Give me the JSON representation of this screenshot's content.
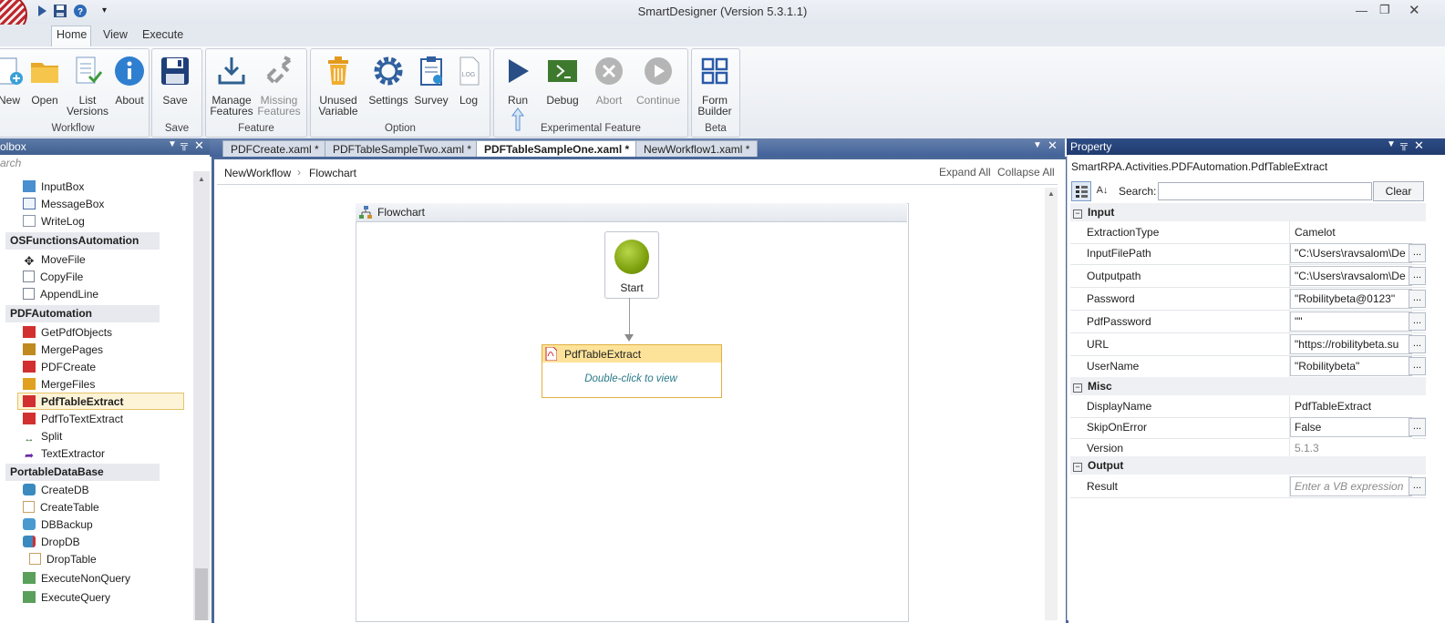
{
  "window": {
    "title": "SmartDesigner (Version 5.3.1.1)"
  },
  "ribbon": {
    "tabs": [
      "Home",
      "View",
      "Execute"
    ],
    "groups": [
      {
        "label": "Workflow",
        "buttons": [
          "New",
          "Open",
          "List Versions",
          "About"
        ]
      },
      {
        "label": "Save",
        "buttons": [
          "Save"
        ]
      },
      {
        "label": "Feature",
        "buttons": [
          "Manage Features",
          "Missing Features"
        ]
      },
      {
        "label": "Option",
        "buttons": [
          "Unused Variable",
          "Settings",
          "Survey",
          "Log"
        ]
      },
      {
        "label": "Experimental Feature",
        "buttons": [
          "Run",
          "Debug",
          "Abort",
          "Continue"
        ]
      },
      {
        "label": "Beta",
        "buttons": [
          "Form Builder"
        ]
      }
    ],
    "new": "New",
    "open": "Open",
    "list1": "List",
    "list2": "Versions",
    "about": "About",
    "save": "Save",
    "manage1": "Manage",
    "manage2": "Features",
    "missing1": "Missing",
    "missing2": "Features",
    "unused1": "Unused",
    "unused2": "Variable",
    "settings": "Settings",
    "survey": "Survey",
    "log": "Log",
    "run": "Run",
    "debug": "Debug",
    "abort": "Abort",
    "continue": "Continue",
    "form1": "Form",
    "form2": "Builder",
    "g_workflow": "Workflow",
    "g_save": "Save",
    "g_feature": "Feature",
    "g_option": "Option",
    "g_experimental": "Experimental Feature",
    "g_beta": "Beta"
  },
  "toolbox": {
    "title": "olbox",
    "search_placeholder": "arch",
    "items_top": [
      "InputBox",
      "MessageBox",
      "WriteLog"
    ],
    "cat_os": "OSFunctionsAutomation",
    "items_os": [
      "MoveFile",
      "CopyFile",
      "AppendLine"
    ],
    "cat_pdf": "PDFAutomation",
    "items_pdf": [
      "GetPdfObjects",
      "MergePages",
      "PDFCreate",
      "MergeFiles",
      "PdfTableExtract",
      "PdfToTextExtract",
      "Split",
      "TextExtractor"
    ],
    "cat_db": "PortableDataBase",
    "items_db": [
      "CreateDB",
      "CreateTable",
      "DBBackup",
      "DropDB",
      "DropTable",
      "ExecuteNonQuery",
      "ExecuteQuery"
    ]
  },
  "designer": {
    "tabs": [
      "PDFCreate.xaml *",
      "PDFTableSampleTwo.xaml *",
      "PDFTableSampleOne.xaml *",
      "NewWorkflow1.xaml *"
    ],
    "active_tab": "PDFTableSampleOne.xaml *",
    "breadcrumb": [
      "NewWorkflow",
      "Flowchart"
    ],
    "expand_all": "Expand All",
    "collapse_all": "Collapse All",
    "flowchart_title": "Flowchart",
    "start_label": "Start",
    "activity_title": "PdfTableExtract",
    "activity_hint": "Double-click to view"
  },
  "property": {
    "title": "Property",
    "type_name": "SmartRPA.Activities.PDFAutomation.PdfTableExtract",
    "search_label": "Search:",
    "clear_label": "Clear",
    "categories": {
      "input": "Input",
      "misc": "Misc",
      "output": "Output"
    },
    "rows": {
      "extraction_type": {
        "name": "ExtractionType",
        "value": "Camelot"
      },
      "input_file_path": {
        "name": "InputFilePath",
        "value": "\"C:\\Users\\ravsalom\\De"
      },
      "output_path": {
        "name": "Outputpath",
        "value": "\"C:\\Users\\ravsalom\\De"
      },
      "password": {
        "name": "Password",
        "value": "\"Robilitybeta@0123\""
      },
      "pdf_password": {
        "name": "PdfPassword",
        "value": "\"\""
      },
      "url": {
        "name": "URL",
        "value": "\"https://robilitybeta.su"
      },
      "user_name": {
        "name": "UserName",
        "value": "\"Robilitybeta\""
      },
      "display_name": {
        "name": "DisplayName",
        "value": "PdfTableExtract"
      },
      "skip_on_error": {
        "name": "SkipOnError",
        "value": "False"
      },
      "version": {
        "name": "Version",
        "value": "5.1.3"
      },
      "result": {
        "name": "Result",
        "placeholder": "Enter a VB expression"
      }
    },
    "dots": "..."
  }
}
